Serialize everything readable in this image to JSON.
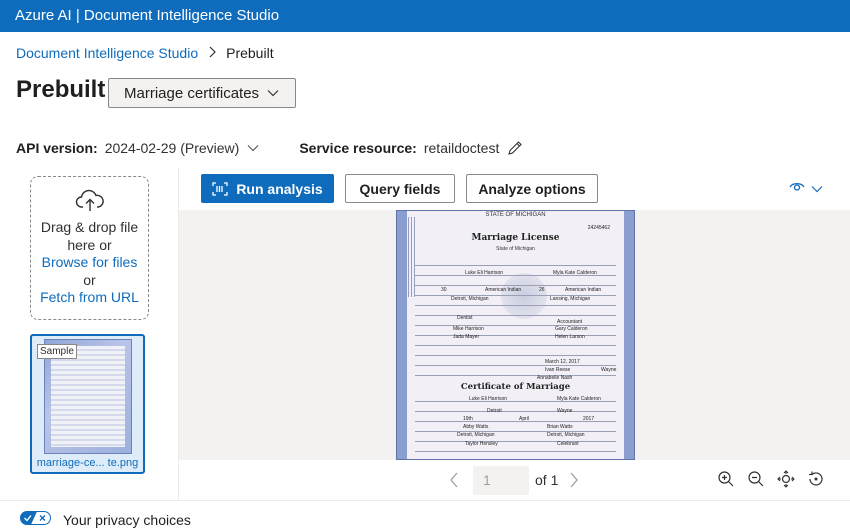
{
  "app": {
    "title": "Azure AI | Document Intelligence Studio"
  },
  "breadcrumb": {
    "root": "Document Intelligence Studio",
    "current": "Prebuilt"
  },
  "page": {
    "title": "Prebuilt",
    "model_selected": "Marriage certificates"
  },
  "settings": {
    "api_version_label": "API version:",
    "api_version_value": "2024-02-29 (Preview)",
    "service_label": "Service resource:",
    "service_value": "retaildoctest"
  },
  "upload": {
    "drag_text": "Drag & drop file here or",
    "browse_link": "Browse for files",
    "or_text": "or",
    "fetch_link": "Fetch from URL"
  },
  "file": {
    "sample_tag": "Sample",
    "name": "marriage-ce... te.png"
  },
  "toolbar": {
    "run_label": "Run analysis",
    "query_label": "Query fields",
    "analyze_options_label": "Analyze options"
  },
  "document": {
    "state": "STATE OF MICHIGAN",
    "title": "Marriage License",
    "subtitle": "State of Michigan",
    "record_no": "24245462",
    "groom_name": "Luke Eli Harrison",
    "bride_name": "Myla Kate Calderon",
    "groom_age": "30",
    "groom_race": "American Indian",
    "bride_age": "26",
    "bride_race": "American Indian",
    "groom_city": "Detroit, Michigan",
    "bride_city": "Lansing, Michigan",
    "groom_occupation": "Dentist",
    "bride_occupation": "Accountant",
    "groom_father": "Mike Harrison",
    "bride_father": "Gary Calderon",
    "groom_mother": "Jada Mayer",
    "bride_mother": "Helen Larson",
    "application_date": "March 12, 2017",
    "clerk": "Ivan Reese",
    "county": "Wayne",
    "deputy": "Annabelle Nash",
    "certificate_title": "Certificate of Marriage",
    "cert_groom": "Luke Eli Harrison",
    "cert_bride": "Myla Kate Calderon",
    "cert_city": "Detroit",
    "cert_county": "Wayne",
    "cert_day": "19th",
    "cert_month": "April",
    "cert_year": "2017",
    "witness1": "Abby Watts",
    "witness2": "Brian Watts",
    "witness1_city": "Detroit, Michigan",
    "witness2_city": "Detroit, Michigan",
    "officiant": "Taylor Hensley",
    "officiant_title": "Celebrant"
  },
  "pager": {
    "current_page": "1",
    "of_text": "of 1"
  },
  "footer": {
    "privacy_text": "Your privacy choices"
  },
  "icons": {
    "accent": "#0f6cbd",
    "breadcrumb_separator": "chevron-right-icon",
    "upload": "cloud-upload-icon",
    "run": "scan-icon",
    "view": "eye-icon",
    "edit": "pencil-icon"
  }
}
